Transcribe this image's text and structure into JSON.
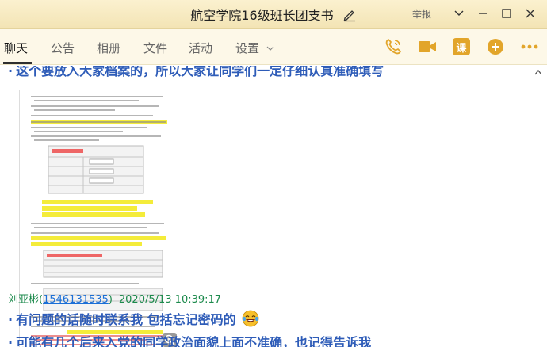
{
  "window": {
    "title": "航空学院16级班长团支书",
    "report_label": "举报"
  },
  "tabs": [
    {
      "label": "聊天",
      "active": true
    },
    {
      "label": "公告"
    },
    {
      "label": "相册"
    },
    {
      "label": "文件"
    },
    {
      "label": "活动"
    },
    {
      "label": "设置"
    }
  ],
  "toolbar": {
    "ke_label": "课"
  },
  "chat": {
    "cut_message": "这个要放入大家档案的，所以大家让同学们一定仔细认真准确填写",
    "sender": {
      "name": "刘亚彬",
      "qq": "1546131535",
      "time": "2020/5/13 10:39:17"
    },
    "messages": [
      {
        "text": "有问题的话随时联系我 包括忘记密码的"
      },
      {
        "text": "可能有几个后来入党的同学政治面貌上面不准确，也记得告诉我"
      }
    ]
  },
  "colors": {
    "titlebar": "#f3e4b5",
    "message_text": "#2e5cb8",
    "sender_name": "#1c8a4c",
    "qq_link": "#1a6ed6",
    "icon_accent": "#e2a52a"
  }
}
